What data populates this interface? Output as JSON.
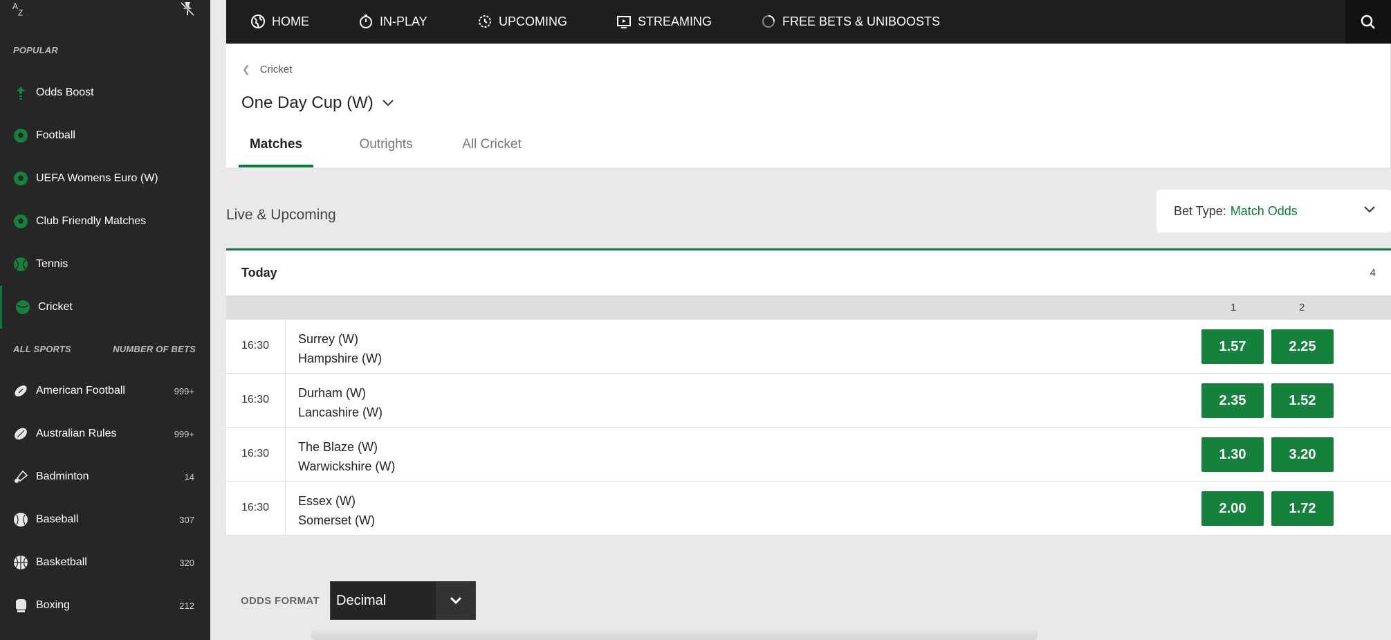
{
  "sidebar": {
    "popular_heading": "POPULAR",
    "popular": [
      {
        "label": "Odds Boost",
        "icon": "odds-boost-icon"
      },
      {
        "label": "Football",
        "icon": "football-icon"
      },
      {
        "label": "UEFA Womens Euro (W)",
        "icon": "football-icon"
      },
      {
        "label": "Club Friendly Matches",
        "icon": "football-icon"
      },
      {
        "label": "Tennis",
        "icon": "tennis-icon"
      },
      {
        "label": "Cricket",
        "icon": "cricket-icon"
      }
    ],
    "all_sports_heading": "ALL SPORTS",
    "number_of_bets_heading": "NUMBER OF BETS",
    "sports": [
      {
        "label": "American Football",
        "count": "999+",
        "icon": "american-football-icon"
      },
      {
        "label": "Australian Rules",
        "count": "999+",
        "icon": "australian-rules-icon"
      },
      {
        "label": "Badminton",
        "count": "14",
        "icon": "badminton-icon"
      },
      {
        "label": "Baseball",
        "count": "307",
        "icon": "baseball-icon"
      },
      {
        "label": "Basketball",
        "count": "320",
        "icon": "basketball-icon"
      },
      {
        "label": "Boxing",
        "count": "212",
        "icon": "boxing-icon"
      }
    ]
  },
  "nav": {
    "home": "HOME",
    "inplay": "IN-PLAY",
    "upcoming": "UPCOMING",
    "streaming": "STREAMING",
    "freebets": "FREE BETS & UNIBOOSTS"
  },
  "header": {
    "breadcrumb": "Cricket",
    "title": "One Day Cup (W)",
    "tabs": [
      "Matches",
      "Outrights",
      "All Cricket"
    ]
  },
  "live": {
    "title": "Live & Upcoming",
    "bet_type_label": "Bet Type:",
    "bet_type_value": "Match Odds",
    "group_label": "Today",
    "group_count": "4",
    "col1": "1",
    "col2": "2",
    "events": [
      {
        "time": "16:30",
        "home": "Surrey (W)",
        "away": "Hampshire (W)",
        "odd1": "1.57",
        "odd2": "2.25"
      },
      {
        "time": "16:30",
        "home": "Durham (W)",
        "away": "Lancashire (W)",
        "odd1": "2.35",
        "odd2": "1.52"
      },
      {
        "time": "16:30",
        "home": "The Blaze (W)",
        "away": "Warwickshire (W)",
        "odd1": "1.30",
        "odd2": "3.20"
      },
      {
        "time": "16:30",
        "home": "Essex (W)",
        "away": "Somerset (W)",
        "odd1": "2.00",
        "odd2": "1.72"
      }
    ]
  },
  "odds_format": {
    "label": "ODDS FORMAT",
    "value": "Decimal"
  },
  "colors": {
    "accent": "#0c7a3e",
    "odds_button": "#16813d",
    "sidebar_bg": "#262626",
    "nav_bg": "#1e1e1e"
  }
}
